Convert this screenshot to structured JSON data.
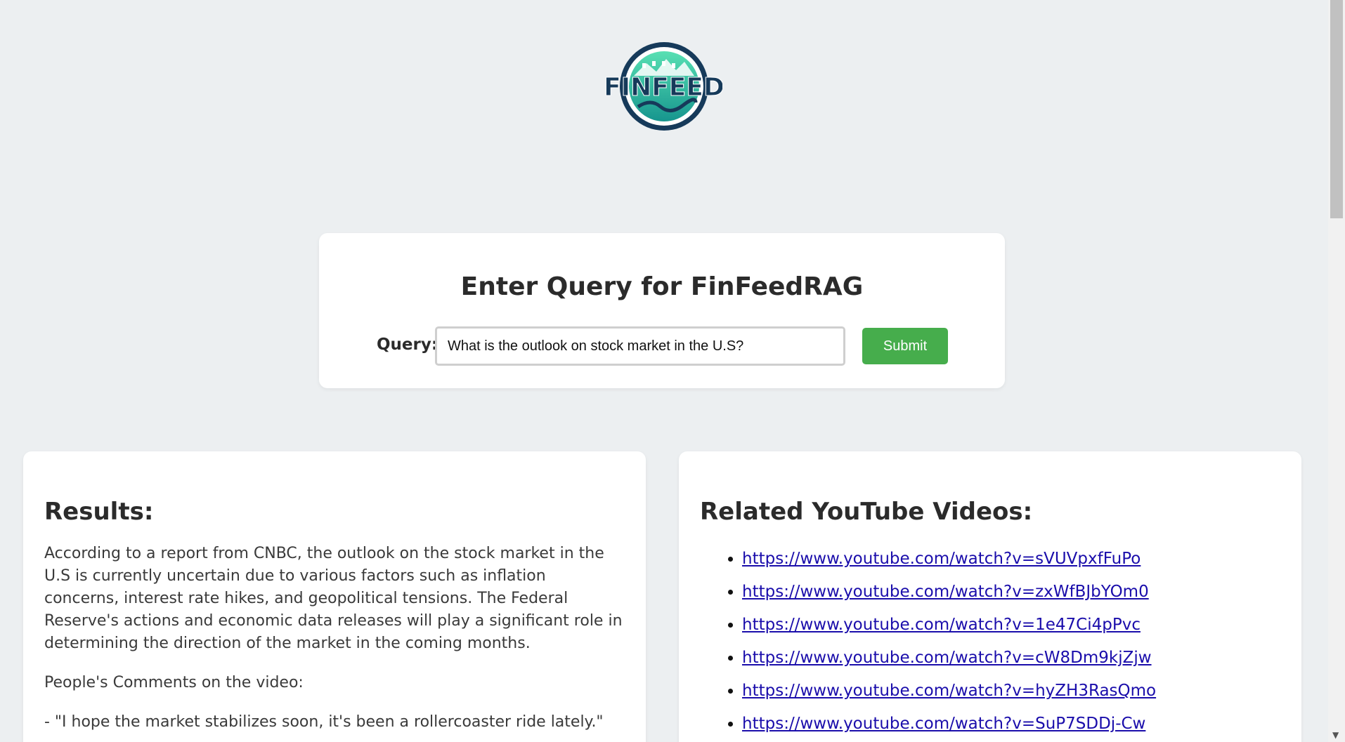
{
  "logo": {
    "text_fin": "FIN",
    "text_feed": "FEED",
    "icon": "finfeed-logo-icon"
  },
  "query_form": {
    "title": "Enter Query for FinFeedRAG",
    "label": "Query:",
    "value": "What is the outlook on stock market in the U.S?",
    "submit_label": "Submit"
  },
  "results": {
    "heading": "Results:",
    "summary": "According to a report from CNBC, the outlook on the stock market in the U.S is currently uncertain due to various factors such as inflation concerns, interest rate hikes, and geopolitical tensions. The Federal Reserve's actions and economic data releases will play a significant role in determining the direction of the market in the coming months.",
    "comments_heading": "People's Comments on the video:",
    "comments": [
      "- \"I hope the market stabilizes soon, it's been a rollercoaster ride lately.\""
    ]
  },
  "videos": {
    "heading": "Related YouTube Videos:",
    "links": [
      "https://www.youtube.com/watch?v=sVUVpxfFuPo",
      "https://www.youtube.com/watch?v=zxWfBJbYOm0",
      "https://www.youtube.com/watch?v=1e47Ci4pPvc",
      "https://www.youtube.com/watch?v=cW8Dm9kjZjw",
      "https://www.youtube.com/watch?v=hyZH3RasQmo",
      "https://www.youtube.com/watch?v=SuP7SDDj-Cw"
    ]
  },
  "colors": {
    "background": "#eceff1",
    "submit_button": "#46ad4c",
    "logo_navy": "#163a5a",
    "logo_teal": "#2fbf9f",
    "link": "#1a0dab"
  }
}
